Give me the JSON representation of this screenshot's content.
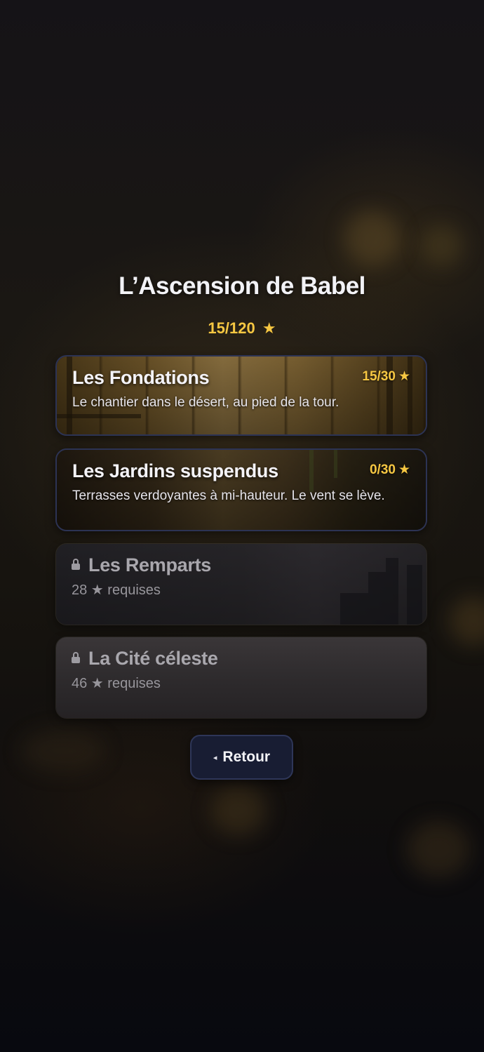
{
  "header": {
    "title": "L’Ascension de Babel",
    "total_stars": "15/120",
    "star_glyph": "★"
  },
  "levels": [
    {
      "name": "Les Fondations",
      "stars": "15/30",
      "description": "Le chantier dans le désert, au pied de la tour.",
      "locked": false
    },
    {
      "name": "Les Jardins suspendus",
      "stars": "0/30",
      "description": "Terrasses verdoyantes à mi-hauteur. Le vent se lève.",
      "locked": false
    },
    {
      "name": "Les Remparts",
      "required": "28 ★ requises",
      "locked": true
    },
    {
      "name": "La Cité céleste",
      "required": "46 ★ requises",
      "locked": true
    }
  ],
  "footer": {
    "back_label": "Retour",
    "back_arrow": "◂"
  },
  "colors": {
    "star_gold": "#f6c742",
    "card_border": "#2c3354",
    "button_bg": "#181d33"
  }
}
